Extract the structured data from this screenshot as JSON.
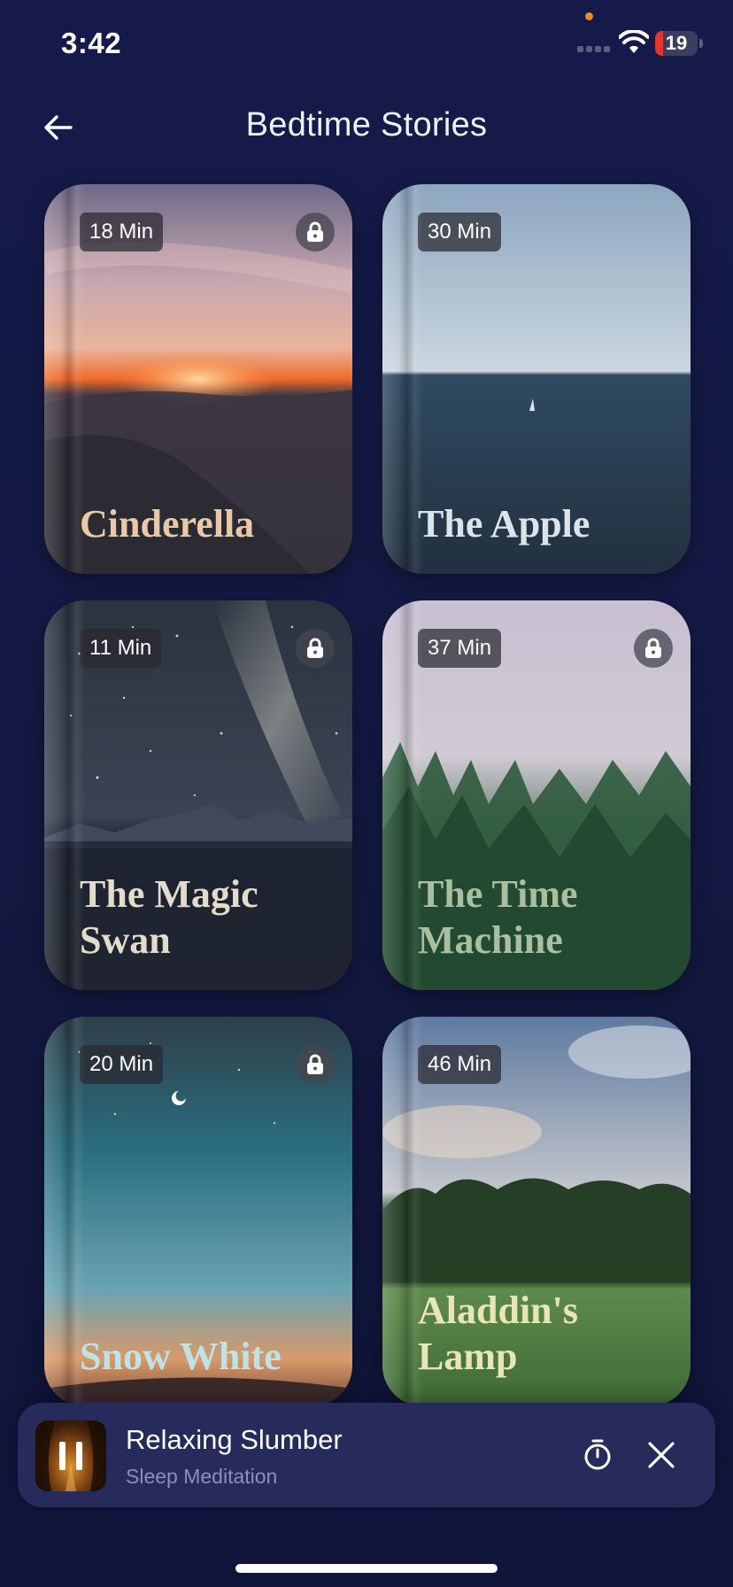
{
  "status_bar": {
    "time": "3:42",
    "battery_level": "19",
    "battery_fraction": 0.19
  },
  "header": {
    "title": "Bedtime Stories",
    "back_icon": "arrow-left-icon"
  },
  "stories": [
    {
      "title": "Cinderella",
      "duration": "18 Min",
      "locked": true,
      "scene": "sunset-mountains",
      "title_color": "#e8c9a8"
    },
    {
      "title": "The Apple",
      "duration": "30 Min",
      "locked": false,
      "scene": "calm-sea",
      "title_color": "#dce4ea"
    },
    {
      "title": "The Magic Swan",
      "duration": "11 Min",
      "locked": true,
      "scene": "milky-way-lake",
      "title_color": "#e4dccb"
    },
    {
      "title": "The Time Machine",
      "duration": "37 Min",
      "locked": true,
      "scene": "misty-forest",
      "title_color": "#a9bf9d"
    },
    {
      "title": "Snow White",
      "duration": "20 Min",
      "locked": true,
      "scene": "twilight-sky",
      "title_color": "#bfe2e6"
    },
    {
      "title": "Aladdin's Lamp",
      "duration": "46 Min",
      "locked": false,
      "scene": "meadow-clouds",
      "title_color": "#e8e6b8"
    }
  ],
  "player": {
    "title": "Relaxing Slumber",
    "subtitle": "Sleep Meditation",
    "state_icon": "pause-icon",
    "timer_icon": "stopwatch-icon",
    "close_icon": "close-icon"
  },
  "colors": {
    "background": "#141a44",
    "player_bg": "#262b5c",
    "battery_low": "#e5352e"
  }
}
